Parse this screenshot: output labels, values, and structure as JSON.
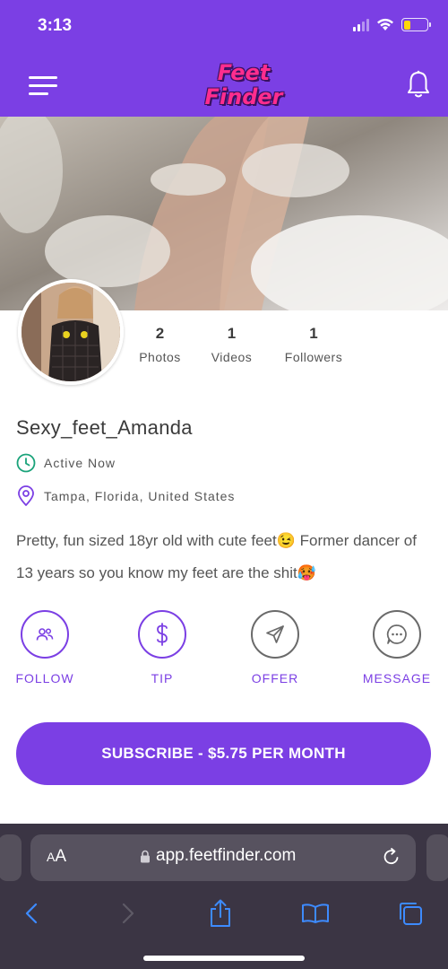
{
  "status_bar": {
    "time": "3:13",
    "battery_color": "#ffd60a"
  },
  "brand": {
    "logo_line1": "Feet",
    "logo_line2": "Finder",
    "accent": "#7b3fe4",
    "logo_pink": "#ff2d8e"
  },
  "nav": {
    "menu_icon": "hamburger-icon",
    "notifications_icon": "bell-icon"
  },
  "profile": {
    "username": "Sexy_feet_Amanda",
    "status": "Active Now",
    "location": "Tampa, Florida, United States",
    "bio": "Pretty, fun sized 18yr old with cute feet😉 Former dancer of 13 years so you know my feet are the shit🥵",
    "stats": [
      {
        "value": "2",
        "label": "Photos"
      },
      {
        "value": "1",
        "label": "Videos"
      },
      {
        "value": "1",
        "label": "Followers"
      }
    ]
  },
  "actions": [
    {
      "label": "FOLLOW",
      "icon": "users-icon"
    },
    {
      "label": "TIP",
      "icon": "dollar-icon"
    },
    {
      "label": "OFFER",
      "icon": "paper-plane-icon"
    },
    {
      "label": "MESSAGE",
      "icon": "chat-bubble-icon"
    }
  ],
  "subscribe": {
    "label": "SUBSCRIBE - $5.75 PER MONTH"
  },
  "browser": {
    "text_size_big": "A",
    "text_size_small": "A",
    "url": "app.feetfinder.com"
  }
}
